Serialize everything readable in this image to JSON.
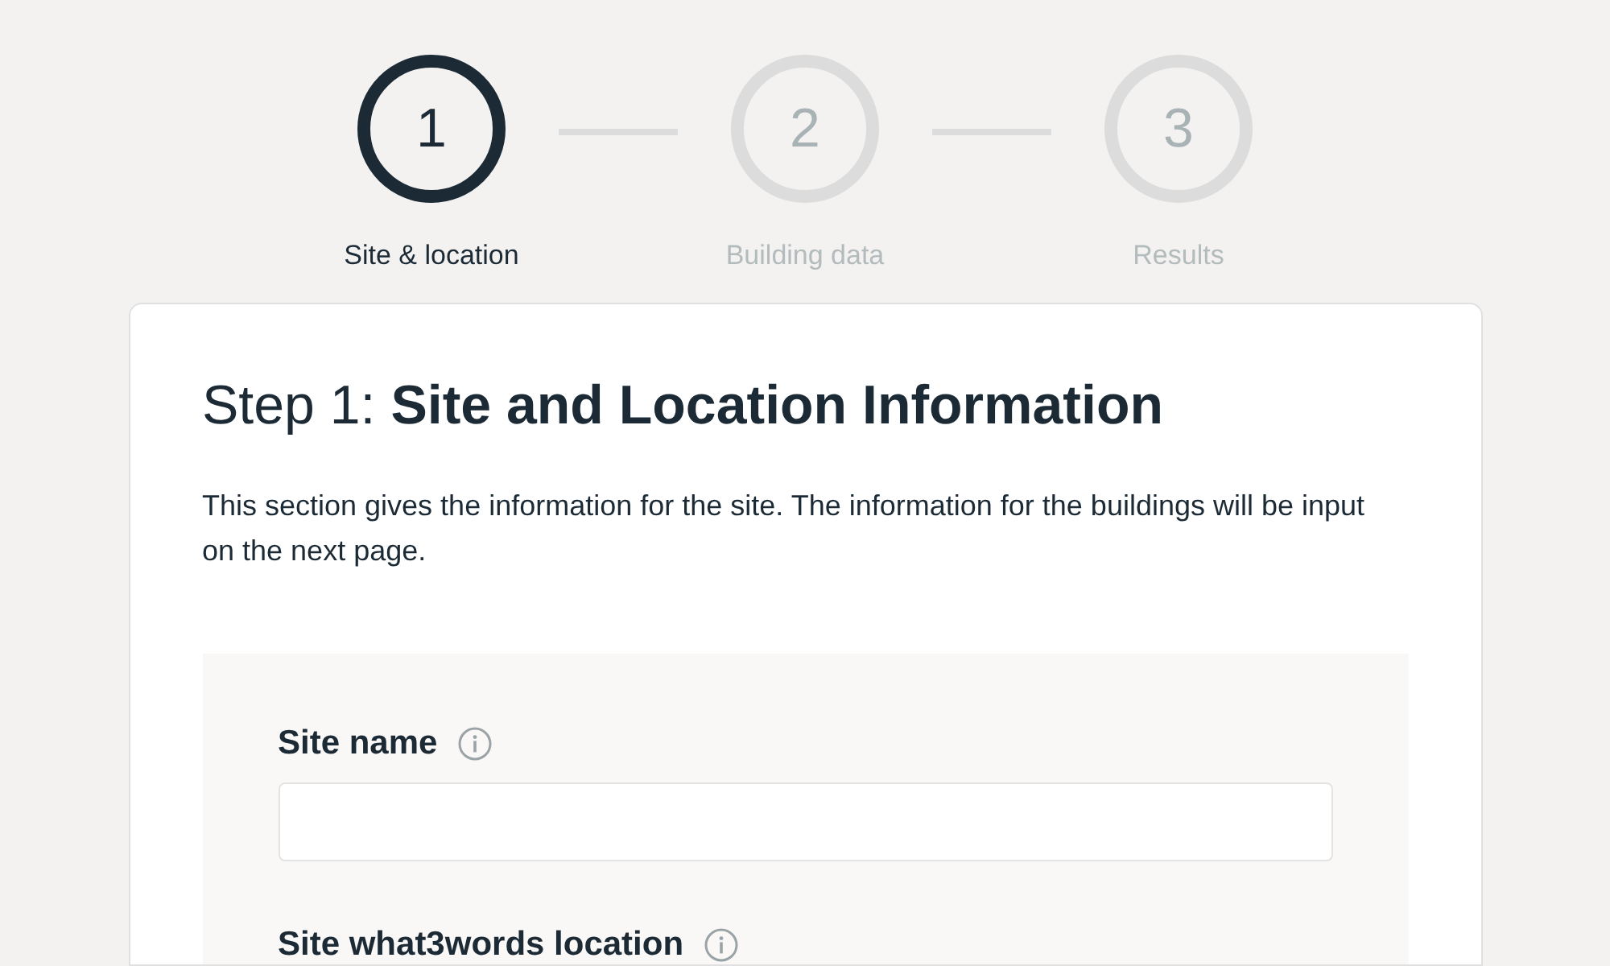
{
  "steps": [
    {
      "number": "1",
      "label": "Site & location",
      "selected": true
    },
    {
      "number": "2",
      "label": "Building data",
      "selected": false
    },
    {
      "number": "3",
      "label": "Results",
      "selected": false
    }
  ],
  "card": {
    "title_prefix": "Step 1:",
    "title": "Site and Location Information",
    "intro": "This section gives the information for the site. The information for the buildings will be input on the next page.",
    "fields": [
      {
        "label": "Site name",
        "kind": "text"
      },
      {
        "label": "Site what3words location"
      }
    ]
  }
}
